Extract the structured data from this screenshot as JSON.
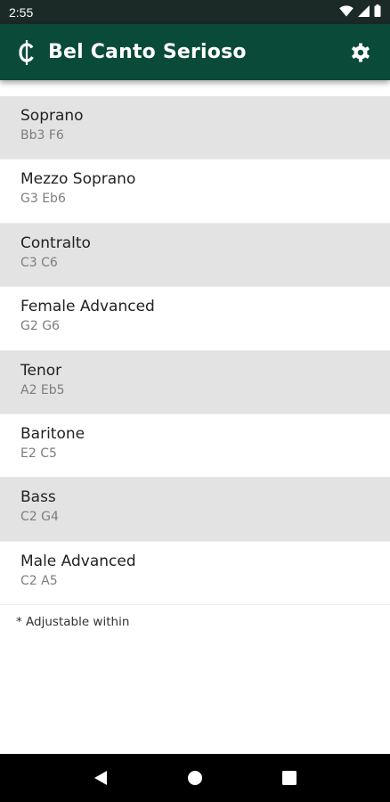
{
  "status_bar": {
    "time": "2:55",
    "icons": [
      "wifi-icon",
      "signal-icon",
      "battery-icon"
    ]
  },
  "app_bar": {
    "logo_icon": "cut-time-c-icon",
    "title": "Bel Canto Serioso",
    "settings_icon": "gear-icon",
    "color": "#0a4a38"
  },
  "voices": [
    {
      "name": "Soprano",
      "range": "Bb3 F6"
    },
    {
      "name": "Mezzo Soprano",
      "range": "G3 Eb6"
    },
    {
      "name": "Contralto",
      "range": "C3 C6"
    },
    {
      "name": "Female Advanced",
      "range": "G2 G6"
    },
    {
      "name": "Tenor",
      "range": "A2 Eb5"
    },
    {
      "name": "Baritone",
      "range": "E2 C5"
    },
    {
      "name": "Bass",
      "range": "C2 G4"
    },
    {
      "name": "Male Advanced",
      "range": "C2 A5"
    }
  ],
  "footnote": "* Adjustable within",
  "nav_bar": {
    "icons": [
      "back-icon",
      "home-icon",
      "recents-icon"
    ]
  }
}
